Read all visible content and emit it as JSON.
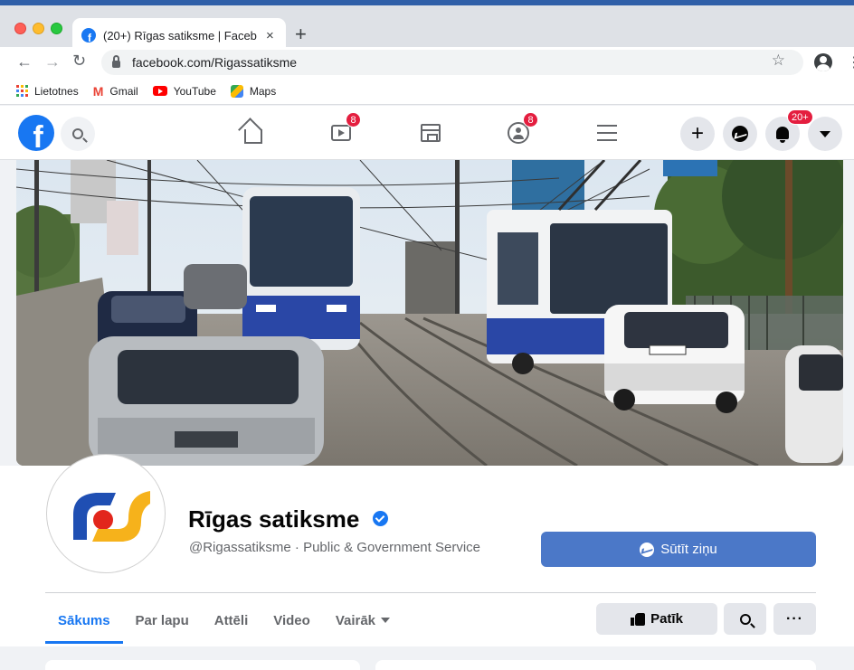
{
  "browser": {
    "tab_title": "(20+) Rīgas satiksme | Facebook",
    "tab_close": "×",
    "new_tab": "+",
    "url": "facebook.com/Rigassatiksme"
  },
  "bookmarks": [
    {
      "label": "Lietotnes",
      "icon": "apps-grid-icon"
    },
    {
      "label": "Gmail",
      "icon": "gmail-icon"
    },
    {
      "label": "YouTube",
      "icon": "youtube-icon"
    },
    {
      "label": "Maps",
      "icon": "maps-icon"
    }
  ],
  "facebook_nav": {
    "logo": "f",
    "watch_badge": "8",
    "groups_badge": "8",
    "notifications_badge": "20+",
    "create_label": "+"
  },
  "page": {
    "name": "Rīgas satiksme",
    "subtitle": "@Rigassatiksme · Public & Government Service",
    "message_button": "Sūtīt ziņu",
    "tabs": [
      "Sākums",
      "Par lapu",
      "Attēli",
      "Video",
      "Vairāk"
    ],
    "active_tab": 0,
    "like_button": "Patīk",
    "more_button": "···"
  },
  "colors": {
    "fb_blue": "#1877f2",
    "message_button": "#4b78c8",
    "badge_red": "#e41e3f",
    "logo_blue": "#1f4fb3",
    "logo_red": "#e2261c",
    "logo_yellow": "#f6b21b"
  }
}
